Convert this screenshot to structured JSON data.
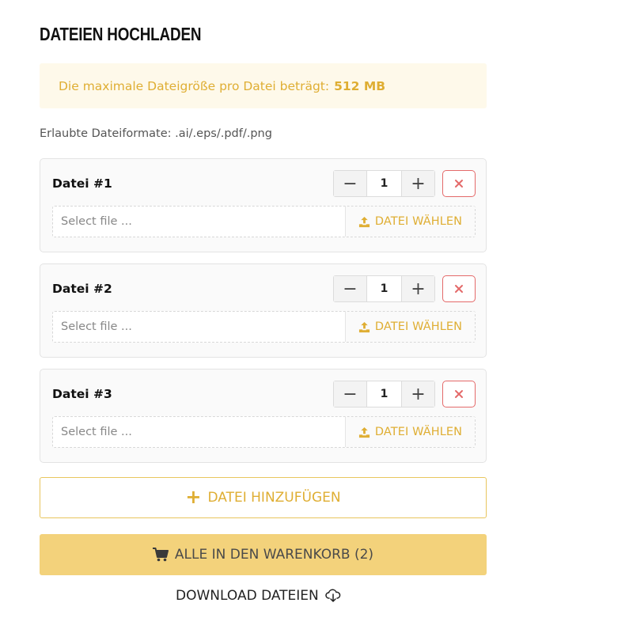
{
  "title": "DATEIEN HOCHLADEN",
  "notice": {
    "text": "Die maximale Dateigröße pro Datei beträgt:",
    "value": "512 MB"
  },
  "formats": "Erlaubte Dateiformate: .ai/.eps/.pdf/.png",
  "files": [
    {
      "label": "Datei #1",
      "quantity": "1",
      "placeholder": "Select file ...",
      "choose_label": "DATEI WÄHLEN"
    },
    {
      "label": "Datei #2",
      "quantity": "1",
      "placeholder": "Select file ...",
      "choose_label": "DATEI WÄHLEN"
    },
    {
      "label": "Datei #3",
      "quantity": "1",
      "placeholder": "Select file ...",
      "choose_label": "DATEI WÄHLEN"
    }
  ],
  "add_button": {
    "label": "DATEI HINZUFÜGEN",
    "icon": "plus-icon"
  },
  "cart_button": {
    "label": "ALLE IN DEN WARENKORB (2)",
    "icon": "cart-icon"
  },
  "download": {
    "label": "DOWNLOAD DATEIEN",
    "icon": "cloud-download-icon"
  },
  "colors": {
    "accent": "#dfae33",
    "notice_bg": "#fef9ea",
    "cart_bg": "#f3d27b",
    "remove": "#e46a6a"
  }
}
